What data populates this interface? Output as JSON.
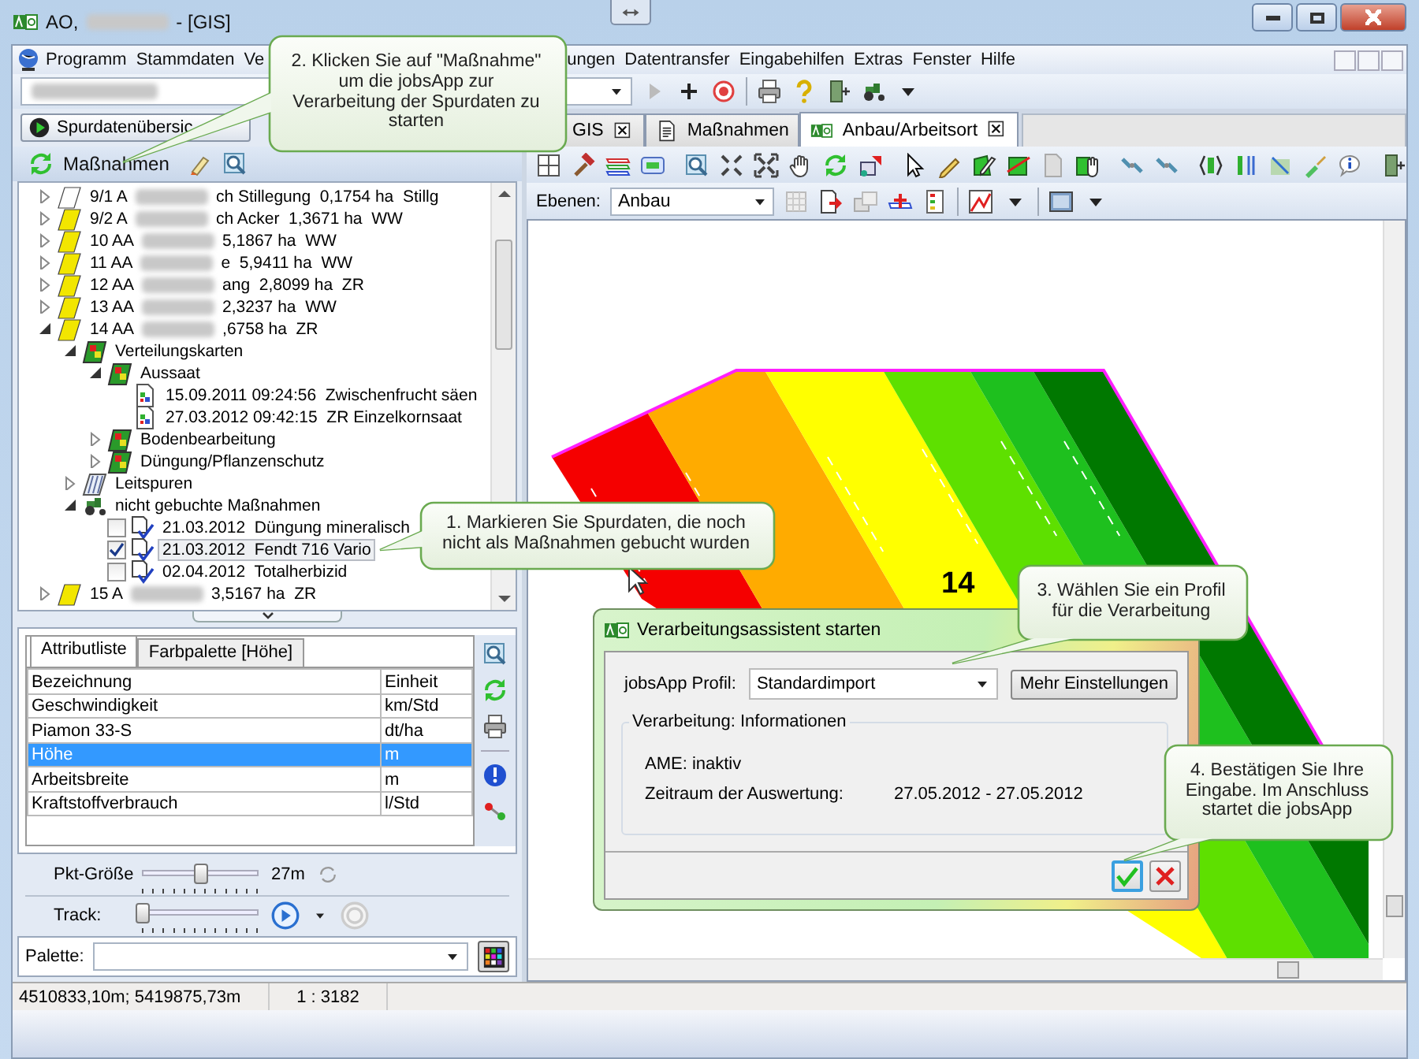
{
  "window": {
    "app_prefix": "AO,",
    "title_suffix": "- [GIS]"
  },
  "menu": [
    {
      "label": "Programm"
    },
    {
      "label": "Stammdaten"
    },
    {
      "label": "Ve"
    },
    {
      "label": "ungen"
    },
    {
      "label": "Datentransfer"
    },
    {
      "label": "Eingabehilfen"
    },
    {
      "label": "Extras"
    },
    {
      "label": "Fenster"
    },
    {
      "label": "Hilfe"
    }
  ],
  "left_panel": {
    "overview_button": "Spurdatenübersic",
    "header": "Maßnahmen",
    "tree": [
      {
        "kind": "field",
        "color": "#ffffff",
        "expanded": false,
        "selected": false,
        "text": "9/1 A",
        "text_after": "ch Stillegung  0,1754 ha  Stillg"
      },
      {
        "kind": "field",
        "color": "#f2e600",
        "expanded": false,
        "selected": false,
        "text": "9/2 A",
        "text_after": "ch Acker  1,3671 ha  WW"
      },
      {
        "kind": "field",
        "color": "#f2e600",
        "expanded": false,
        "selected": false,
        "text": "10 AA",
        "text_after": "5,1867 ha  WW"
      },
      {
        "kind": "field",
        "color": "#f2e600",
        "expanded": false,
        "selected": false,
        "text": "11 AA",
        "text_after": "e  5,9411 ha  WW"
      },
      {
        "kind": "field",
        "color": "#f2e600",
        "expanded": false,
        "selected": false,
        "text": "12 AA",
        "text_after": "ang  2,8099 ha  ZR"
      },
      {
        "kind": "field",
        "color": "#f2e600",
        "expanded": false,
        "selected": false,
        "text": "13 AA",
        "text_after": "2,3237 ha  WW"
      },
      {
        "kind": "field",
        "color": "#f2e600",
        "expanded": true,
        "selected": false,
        "text": "14 AA",
        "text_after": ",6758 ha  ZR",
        "children": [
          {
            "kind": "map",
            "expanded": true,
            "selected": false,
            "text": "Verteilungskarten",
            "children": [
              {
                "kind": "map",
                "expanded": true,
                "selected": false,
                "text": "Aussaat",
                "children": [
                  {
                    "kind": "document",
                    "selected": false,
                    "text": "15.09.2011 09:24:56  Zwischenfrucht säen"
                  },
                  {
                    "kind": "document",
                    "selected": false,
                    "text": "27.03.2012 09:42:15  ZR Einzelkornsaat"
                  }
                ]
              },
              {
                "kind": "map",
                "expanded": false,
                "selected": false,
                "text": "Bodenbearbeitung"
              },
              {
                "kind": "map",
                "expanded": false,
                "selected": false,
                "text": "Düngung/Pflanzenschutz"
              }
            ]
          },
          {
            "kind": "tracks",
            "expanded": false,
            "selected": false,
            "text": "Leitspuren"
          },
          {
            "kind": "tractor",
            "expanded": true,
            "selected": false,
            "text": "nicht gebuchte Maßnahmen",
            "children": [
              {
                "kind": "measure",
                "checked": false,
                "selected": false,
                "text": "21.03.2012  Düngung mineralisch"
              },
              {
                "kind": "measure",
                "checked": true,
                "selected": true,
                "text": "21.03.2012  Fendt 716 Vario"
              },
              {
                "kind": "measure",
                "checked": false,
                "selected": false,
                "text": "02.04.2012  Totalherbizid"
              }
            ]
          }
        ]
      },
      {
        "kind": "field",
        "color": "#f2e600",
        "expanded": false,
        "selected": false,
        "text": "15 A",
        "text_after": "3,5167 ha  ZR"
      }
    ]
  },
  "attributes": {
    "tabs": [
      {
        "label": "Attributliste",
        "selected": true
      },
      {
        "label": "Farbpalette [Höhe]",
        "selected": false
      }
    ],
    "columns": [
      "Bezeichnung",
      "Einheit"
    ],
    "rows": [
      {
        "name": "Geschwindigkeit",
        "unit": "km/Std",
        "selected": false
      },
      {
        "name": "Piamon 33-S",
        "unit": "dt/ha",
        "selected": false
      },
      {
        "name": "Höhe",
        "unit": "m",
        "selected": true
      },
      {
        "name": "Arbeitsbreite",
        "unit": "m",
        "selected": false
      },
      {
        "name": "Kraftstoffverbrauch",
        "unit": "l/Std",
        "selected": false
      }
    ]
  },
  "controls": {
    "point_size": {
      "label": "Pkt-Größe",
      "level": 0.5,
      "reading": "27m"
    },
    "track": {
      "label": "Track:",
      "level": 0
    },
    "palette": {
      "label": "Palette:"
    }
  },
  "tabs": [
    {
      "label": "GIS",
      "selected": false
    },
    {
      "label": "Maßnahmen",
      "selected": false
    },
    {
      "label": "Anbau/Arbeitsort",
      "selected": true
    }
  ],
  "map": {
    "layers_label": "Ebenen:",
    "layer": "Anbau",
    "field_label": "14"
  },
  "status_bar": {
    "coordinates": "4510833,10m; 5419875,73m",
    "scale": "1 : 3182"
  },
  "dialog": {
    "title": "Verarbeitungsassistent starten",
    "profile_label": "jobsApp Profil:",
    "profile": "Standardimport",
    "more_button": "Mehr Einstellungen",
    "group_title": "Verarbeitung: Informationen",
    "ame": "AME: inaktiv",
    "period_label": "Zeitraum der Auswertung:",
    "period": "27.05.2012 - 27.05.2012"
  },
  "callouts": [
    {
      "text": "1. Markieren Sie Spurdaten, die noch\nnicht als Maßnahmen gebucht wurden"
    },
    {
      "text": "2. Klicken Sie auf \"Maßnahme\"\num die jobsApp zur\nVerarbeitung der Spurdaten zu\nstarten"
    },
    {
      "text": "3. Wählen Sie ein Profil\nfür die Verarbeitung"
    },
    {
      "text": "4. Bestätigen Sie Ihre\nEingabe. Im Anschluss\nstartet die jobsApp"
    }
  ]
}
